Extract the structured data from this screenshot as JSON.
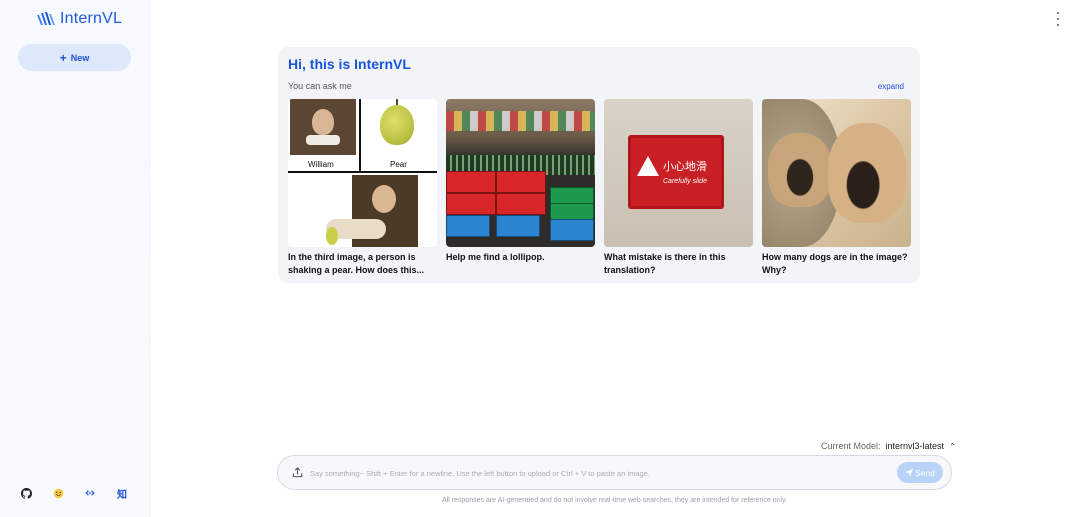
{
  "app": {
    "logo_text": "InternVL"
  },
  "sidebar": {
    "new_label": "New",
    "footer_icons": [
      "github-icon",
      "huggingface-icon",
      "link-icon",
      "zhihu-icon"
    ],
    "zhihu_glyph": "知"
  },
  "welcome": {
    "title": "Hi, this is InternVL",
    "subtitle": "You can ask me",
    "expand_label": "expand",
    "examples": [
      {
        "text": "In the third image, a person is shaking a pear. How does this...",
        "image_labels": [
          "William",
          "Pear"
        ]
      },
      {
        "text": "Help me find a lollipop."
      },
      {
        "text": "What mistake is there in this translation?",
        "sign_cn": "小心地滑",
        "sign_en": "Carefully slide"
      },
      {
        "text": "How many dogs are in the image? Why?"
      }
    ]
  },
  "composer": {
    "model_label": "Current Model:",
    "model_name": "internvl3-latest",
    "placeholder": "Say something~ Shift + Enter for a newline, Use the left button to upload or Ctrl + V to paste an image.",
    "send_label": "Send",
    "disclaimer": "All responses are AI-generated and do not involve real-time web searches, they are intended for reference only."
  },
  "colors": {
    "accent": "#1a56db",
    "new_button_bg": "#dde8fb",
    "send_button_bg": "#b9d3f8",
    "card_bg": "#f2f4f8"
  }
}
